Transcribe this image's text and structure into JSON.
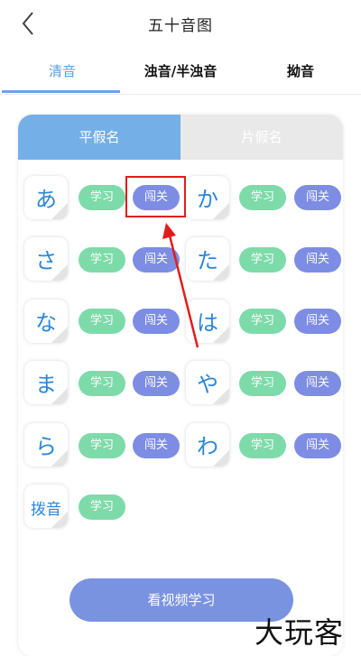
{
  "header": {
    "title": "五十音图"
  },
  "tabs": [
    {
      "label": "清音",
      "active": true
    },
    {
      "label": "浊音/半浊音",
      "active": false
    },
    {
      "label": "拗音",
      "active": false
    }
  ],
  "segment": [
    {
      "label": "平假名",
      "selected": true
    },
    {
      "label": "片假名",
      "selected": false
    }
  ],
  "kana": [
    "あ",
    "か",
    "さ",
    "た",
    "な",
    "は",
    "ま",
    "や",
    "ら",
    "わ",
    "拨音"
  ],
  "buttons": {
    "study": "学习",
    "pass": "闯关"
  },
  "footer": {
    "video_label": "看视频学习"
  },
  "watermark": "大玩客",
  "colors": {
    "accent": "#5b9ee6",
    "study_green": "#7ddba9",
    "pass_purple": "#7d8de4",
    "annotation_red": "#e31b1b"
  }
}
